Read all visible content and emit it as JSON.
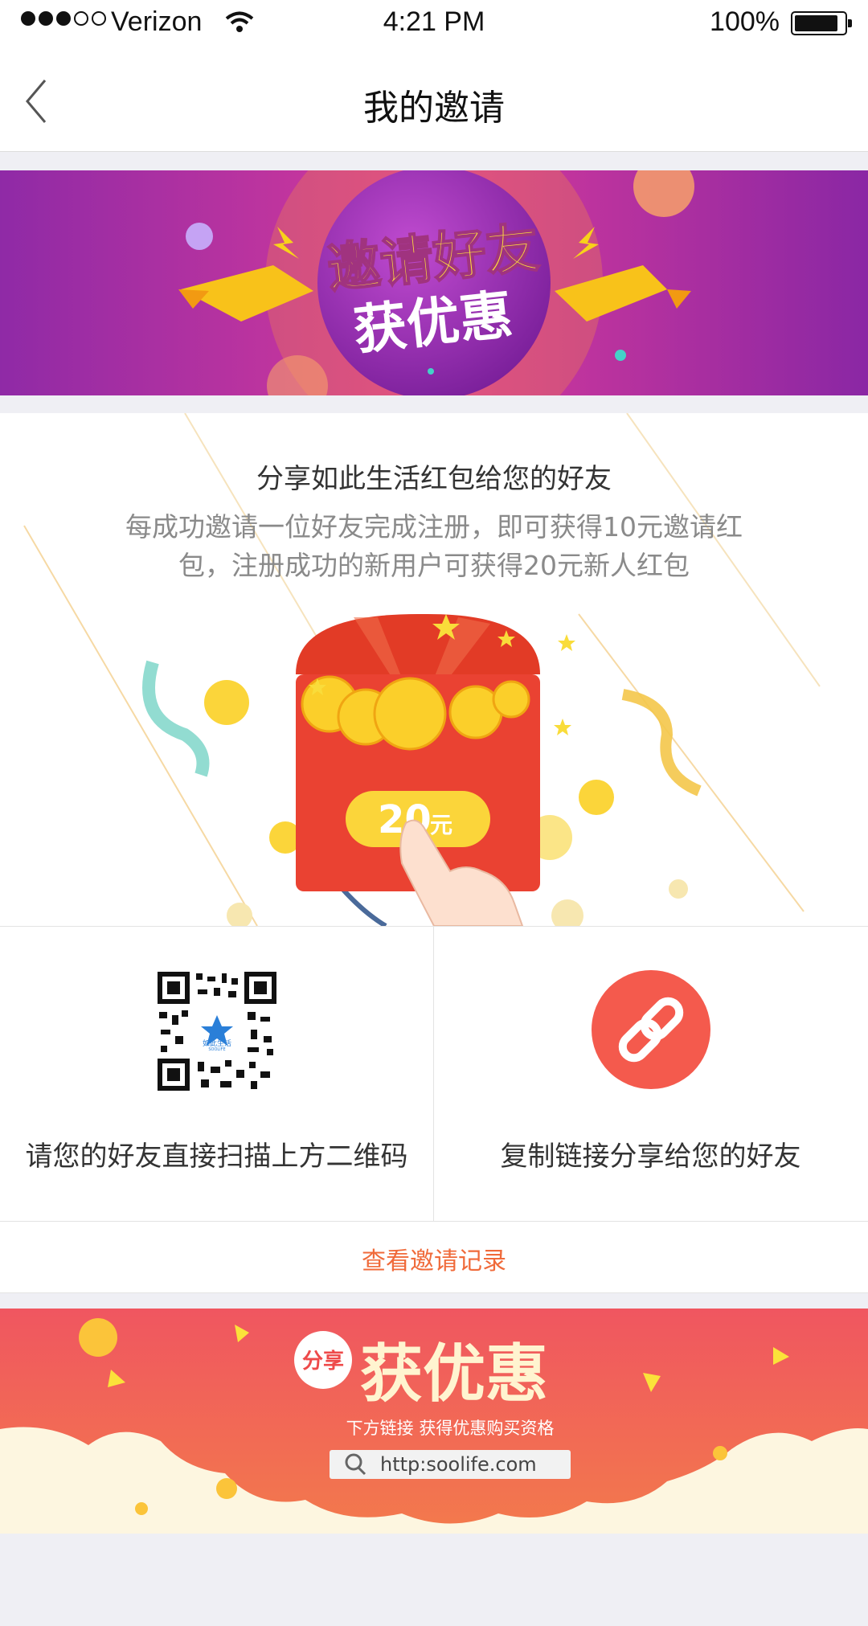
{
  "status_bar": {
    "carrier": "Verizon",
    "time": "4:21 PM",
    "battery": "100%"
  },
  "nav": {
    "title": "我的邀请"
  },
  "banner_top": {
    "line1": "邀请好友",
    "line2": "获优惠"
  },
  "invite_card": {
    "heading": "分享如此生活红包给您的好友",
    "description": "每成功邀请一位好友完成注册，即可获得10元邀请红包，注册成功的新用户可获得20元新人红包",
    "amount_number": "20",
    "amount_unit": "元"
  },
  "share": {
    "qr_label": "请您的好友直接扫描上方二维码",
    "link_label": "复制链接分享给您的好友",
    "qr_logo_text": "如此生活",
    "qr_logo_sub": "SOOLIFE"
  },
  "record_link": "查看邀请记录",
  "banner_bottom": {
    "badge": "分享",
    "headline": "获优惠",
    "subline": "下方链接 获得优惠购买资格",
    "url": "http:soolife.com"
  }
}
